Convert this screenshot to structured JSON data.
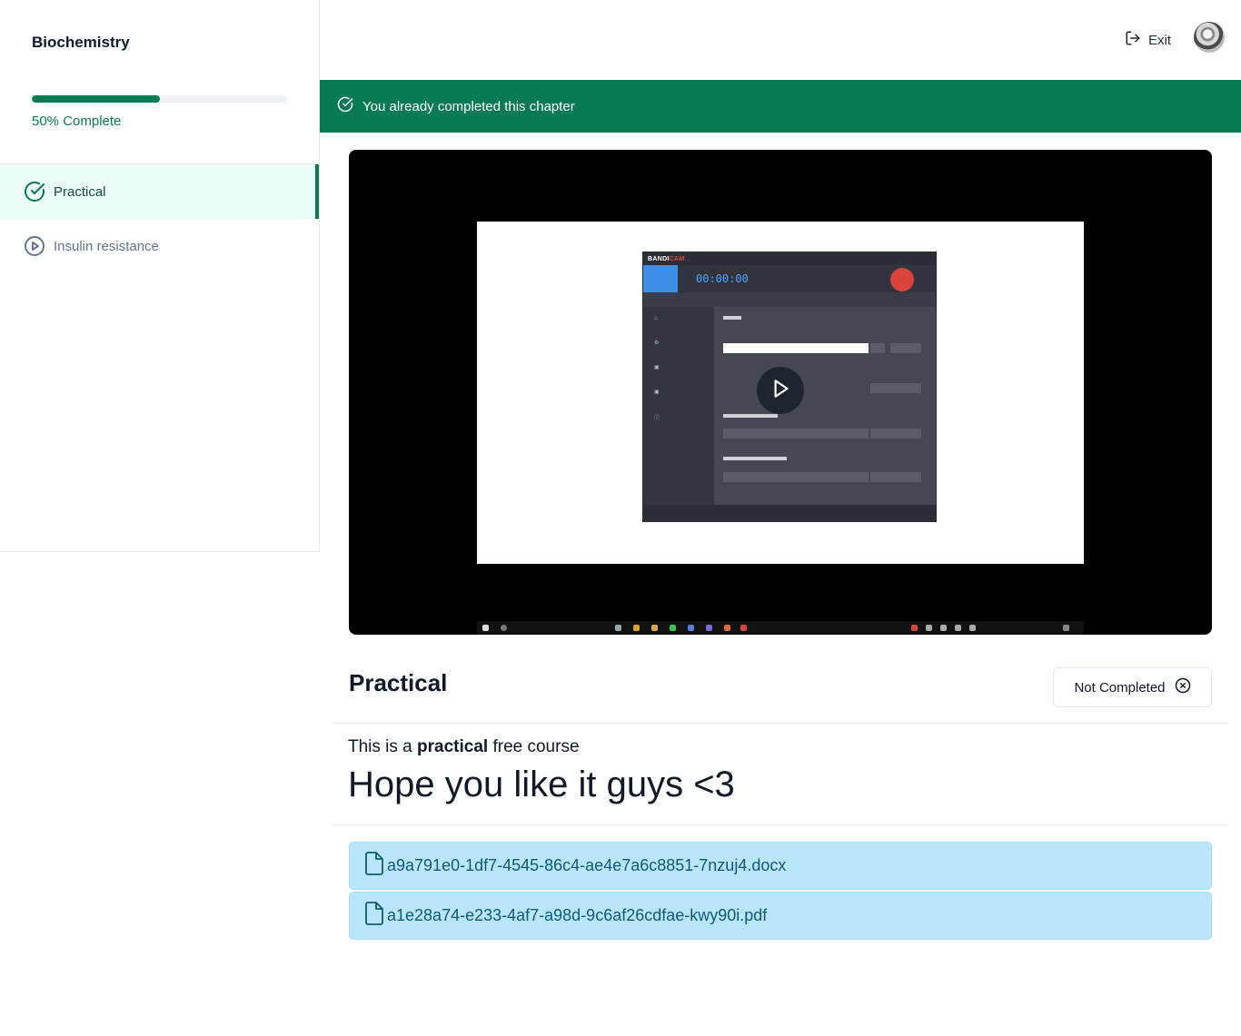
{
  "sidebar": {
    "course_title": "Biochemistry",
    "progress": {
      "percent": 50,
      "label": "50% Complete"
    },
    "chapters": [
      {
        "label": "Practical",
        "completed": true,
        "active": true,
        "icon": "check-circle-icon"
      },
      {
        "label": "Insulin resistance",
        "completed": false,
        "active": false,
        "icon": "play-circle-icon"
      }
    ]
  },
  "header": {
    "exit_label": "Exit",
    "exit_icon": "log-out-icon"
  },
  "banner": {
    "text": "You already completed this chapter",
    "color": "#087a58"
  },
  "video": {
    "thumbnail_app": {
      "brand_prefix": "BANDI",
      "brand_suffix": "CAM",
      "timer": "00:00:00"
    },
    "play_icon": "play-icon"
  },
  "chapter": {
    "title": "Practical",
    "status_label": "Not Completed",
    "status_icon": "x-circle-icon",
    "description": {
      "prefix": "This is a ",
      "bold": "practical",
      "suffix": " free course"
    },
    "headline": "Hope you like it guys <3"
  },
  "attachments": [
    {
      "name": "a9a791e0-1df7-4545-86c4-ae4e7a6c8851-7nzuj4.docx",
      "icon": "file-icon"
    },
    {
      "name": "a1e28a74-e233-4af7-a98d-9c6af26cdfae-kwy90i.pdf",
      "icon": "file-icon"
    }
  ],
  "colors": {
    "accent": "#0a7a56",
    "attachment_bg": "#bae6fd",
    "attachment_text": "#0c5a7a"
  }
}
